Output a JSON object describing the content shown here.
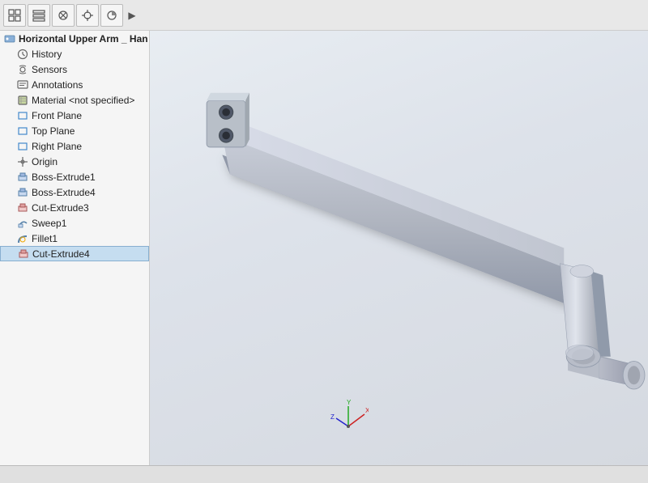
{
  "toolbar": {
    "buttons": [
      "⊞",
      "≡",
      "⊗",
      "⊕",
      "◎"
    ],
    "arrow_label": "▶"
  },
  "sidebar": {
    "root_item": "Horizontal Upper Arm _ Han",
    "items": [
      {
        "id": "history",
        "label": "History",
        "indent": 1,
        "icon": "clock"
      },
      {
        "id": "sensors",
        "label": "Sensors",
        "indent": 1,
        "icon": "sensor"
      },
      {
        "id": "annotations",
        "label": "Annotations",
        "indent": 1,
        "icon": "annotation"
      },
      {
        "id": "material",
        "label": "Material <not specified>",
        "indent": 1,
        "icon": "material"
      },
      {
        "id": "front-plane",
        "label": "Front Plane",
        "indent": 1,
        "icon": "plane"
      },
      {
        "id": "top-plane",
        "label": "Top Plane",
        "indent": 1,
        "icon": "plane"
      },
      {
        "id": "right-plane",
        "label": "Right Plane",
        "indent": 1,
        "icon": "plane"
      },
      {
        "id": "origin",
        "label": "Origin",
        "indent": 1,
        "icon": "origin"
      },
      {
        "id": "boss-extrude1",
        "label": "Boss-Extrude1",
        "indent": 1,
        "icon": "boss"
      },
      {
        "id": "boss-extrude4",
        "label": "Boss-Extrude4",
        "indent": 1,
        "icon": "boss"
      },
      {
        "id": "cut-extrude3",
        "label": "Cut-Extrude3",
        "indent": 1,
        "icon": "cut"
      },
      {
        "id": "sweep1",
        "label": "Sweep1",
        "indent": 1,
        "icon": "sweep"
      },
      {
        "id": "fillet1",
        "label": "Fillet1",
        "indent": 1,
        "icon": "fillet"
      },
      {
        "id": "cut-extrude4",
        "label": "Cut-Extrude4",
        "indent": 1,
        "icon": "cut",
        "selected": true
      }
    ]
  },
  "viewport": {
    "background_color": "#e4e8ee"
  },
  "statusbar": {
    "text": ""
  }
}
